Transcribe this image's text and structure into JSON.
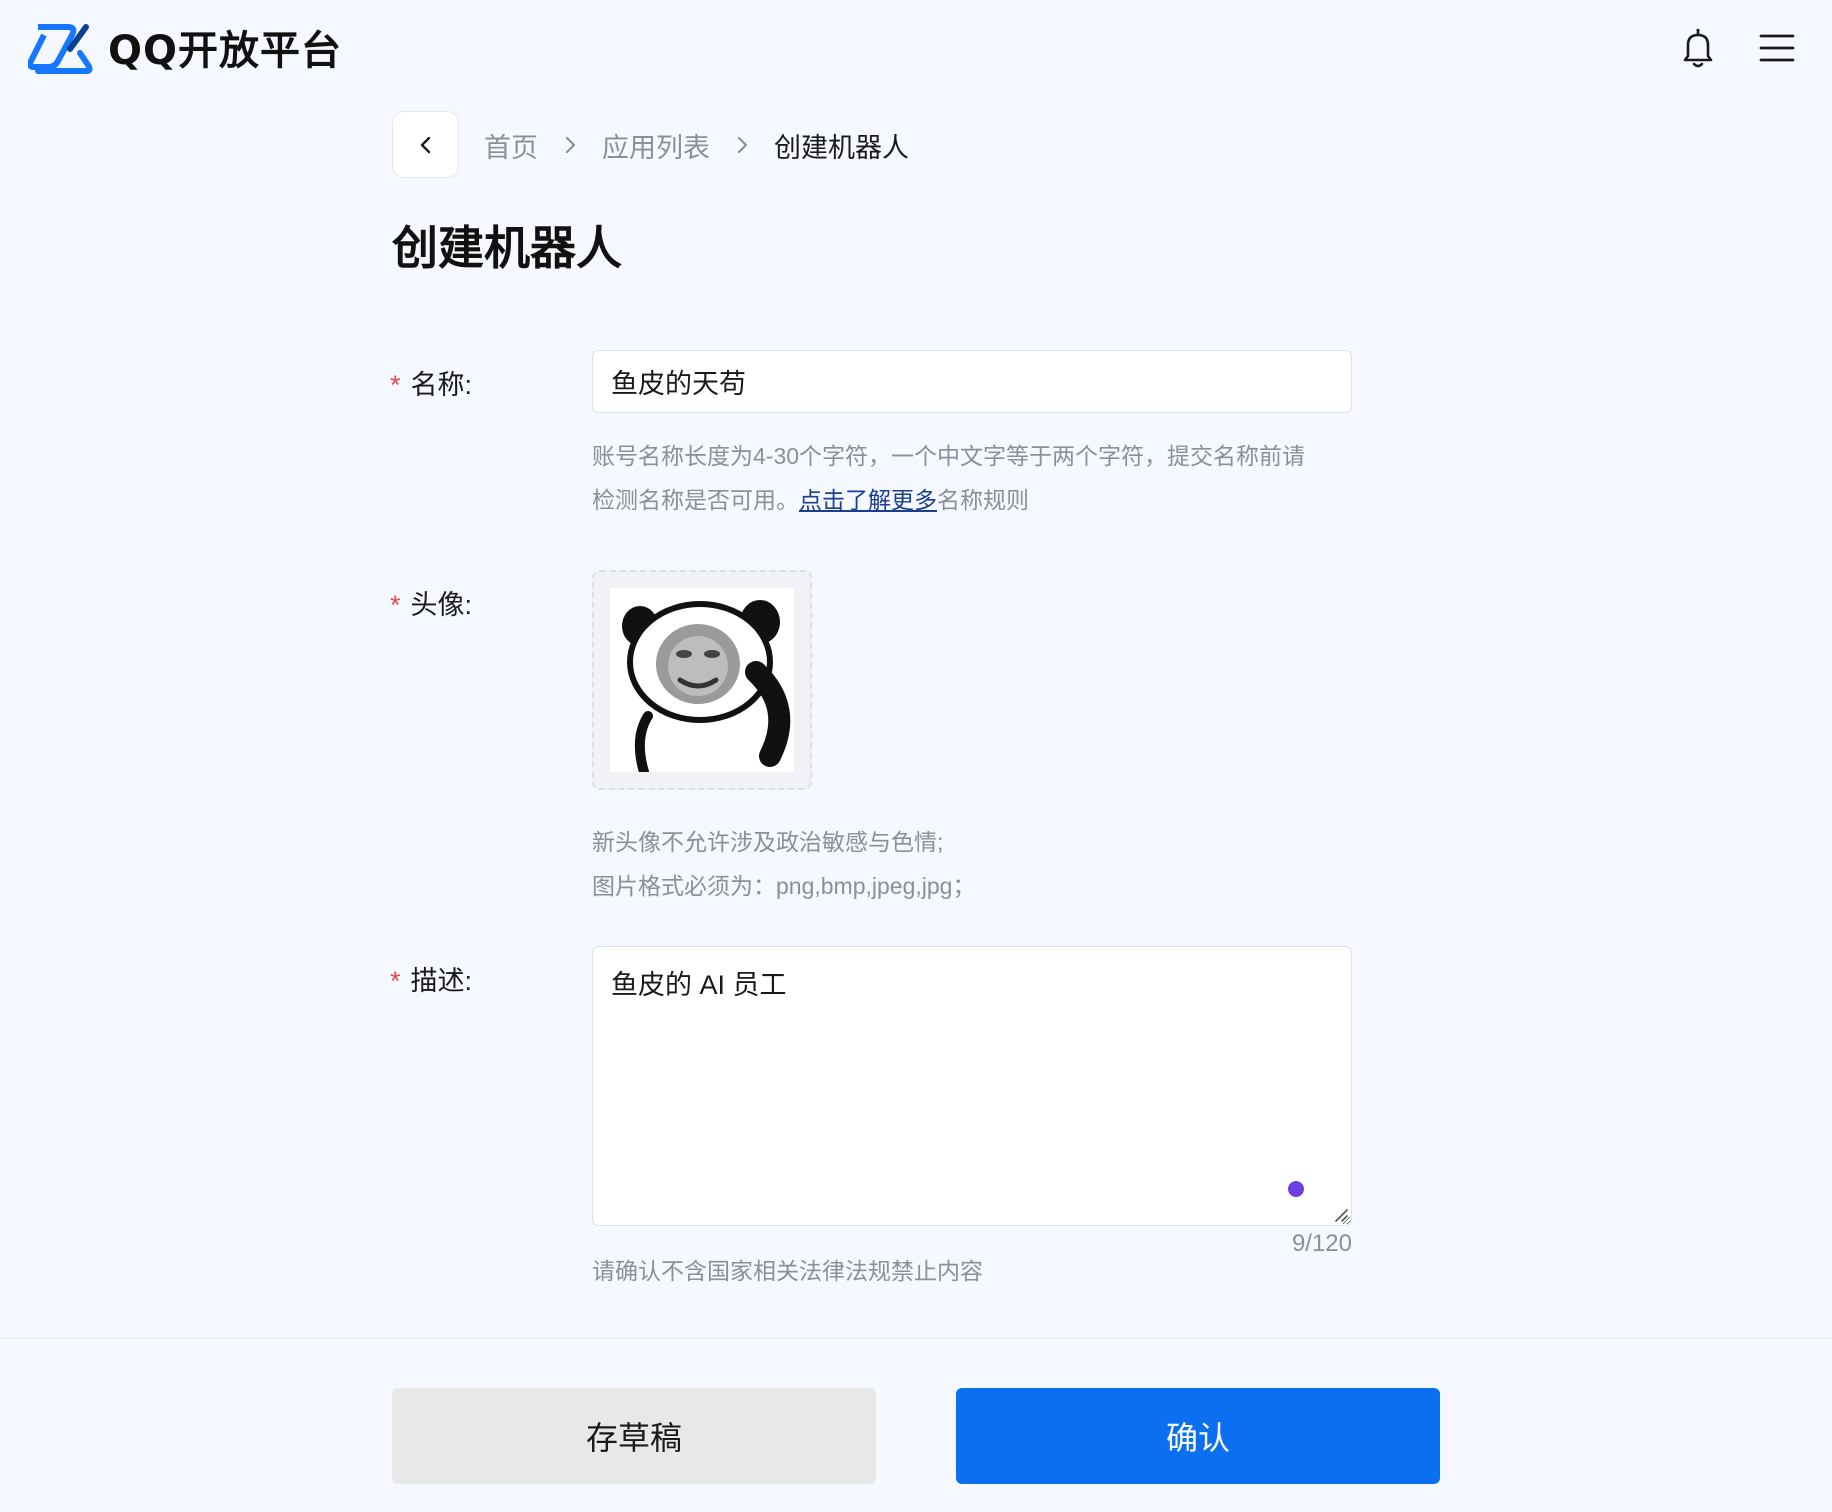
{
  "header": {
    "brand": "QQ开放平台",
    "brand_color": "#1677ff",
    "icons": [
      "qq-open-platform-logo",
      "bell-icon",
      "hamburger-menu-icon"
    ]
  },
  "breadcrumb": {
    "items": [
      "首页",
      "应用列表",
      "创建机器人"
    ]
  },
  "page_title": "创建机器人",
  "form": {
    "name": {
      "required_mark": "*",
      "label": "名称:",
      "value": "鱼皮的天苟",
      "hint_line1": "账号名称长度为4-30个字符，一个中文字等于两个字符，提交名称前请",
      "hint_line2_prefix": "检测名称是否可用。",
      "hint_link": "点击了解更多",
      "hint_line2_suffix": "名称规则"
    },
    "avatar": {
      "required_mark": "*",
      "label": "头像:",
      "hint_line1": "新头像不允许涉及政治敏感与色情;",
      "hint_line2": "图片格式必须为：png,bmp,jpeg,jpg；"
    },
    "description": {
      "required_mark": "*",
      "label": "描述:",
      "value": "鱼皮的 AI 员工",
      "counter": "9/120",
      "hint": "请确认不含国家相关法律法规禁止内容"
    }
  },
  "actions": {
    "draft_label": "存草稿",
    "confirm_label": "确认",
    "confirm_color": "#0b6ff2"
  }
}
